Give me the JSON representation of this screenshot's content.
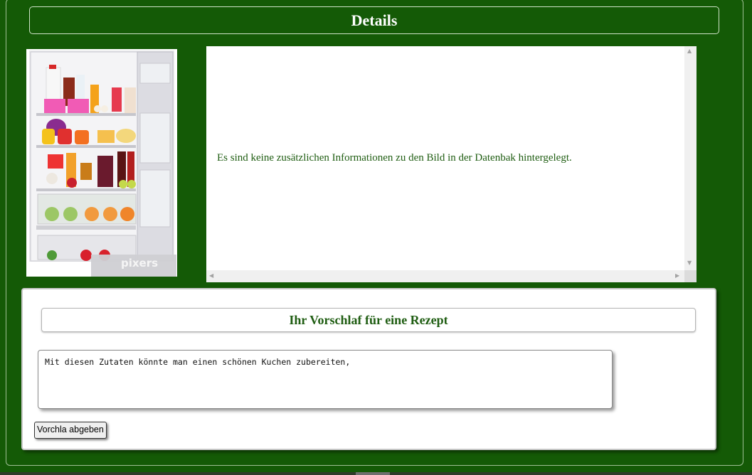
{
  "page": {
    "title": "Details"
  },
  "image": {
    "watermark": "pixers"
  },
  "info": {
    "text": "Es sind keine zusätzlichen Informationen zu den Bild in der Datenbak hintergelegt."
  },
  "recipe": {
    "heading": "Ihr Vorschlaf für eine Rezept",
    "textarea_value": "Mit diesen Zutaten könnte man einen schönen Kuchen zubereiten,",
    "submit_label": "Vorchla abgeben"
  },
  "colors": {
    "background": "#145a06",
    "accent_text": "#1f5d12"
  }
}
